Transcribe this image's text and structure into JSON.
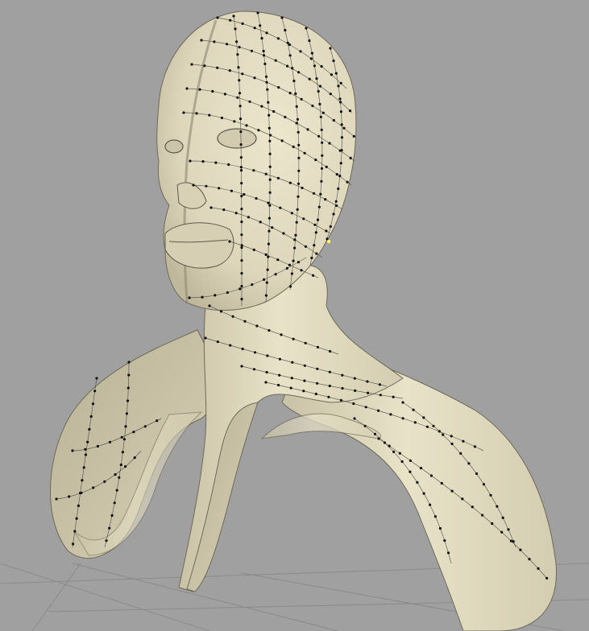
{
  "viewport": {
    "background_color": "#a0a0a0",
    "surface_color": "#e3dcc3",
    "grid_color": "#8a8a8a",
    "selected_vertex_color": "#ffff66"
  }
}
